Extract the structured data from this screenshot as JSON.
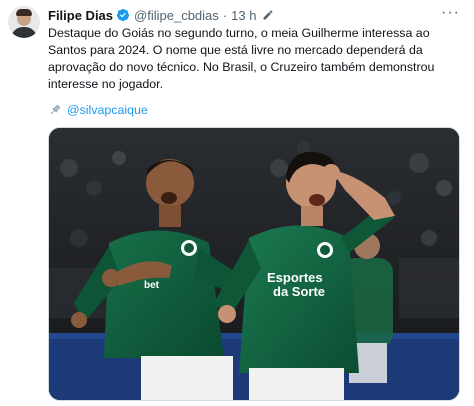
{
  "tweet": {
    "author_name": "Filipe Dias",
    "author_handle": "@filipe_cbdias",
    "separator": "·",
    "time": "13 h",
    "more_label": "···",
    "body": "Destaque do Goiás no segundo turno, o meia Guilherme interessa ao Santos para 2024. O nome que está livre no mercado dependerá da aprovação do novo técnico. No Brasil, o Cruzeiro também demonstrou interesse no jogador.",
    "mention": "@silvapcaique",
    "icons": {
      "verified": "verified-badge-icon",
      "edit": "edit-pencil-icon",
      "link": "pin-icon",
      "more": "more-icon"
    },
    "colors": {
      "verified": "#1d9bf0",
      "link": "#1d9bf0",
      "jersey": "#0f5a3a"
    }
  },
  "photo": {
    "sponsor_left": "bet",
    "sponsor_right_line1": "Esportes",
    "sponsor_right_line2": "da Sorte"
  }
}
